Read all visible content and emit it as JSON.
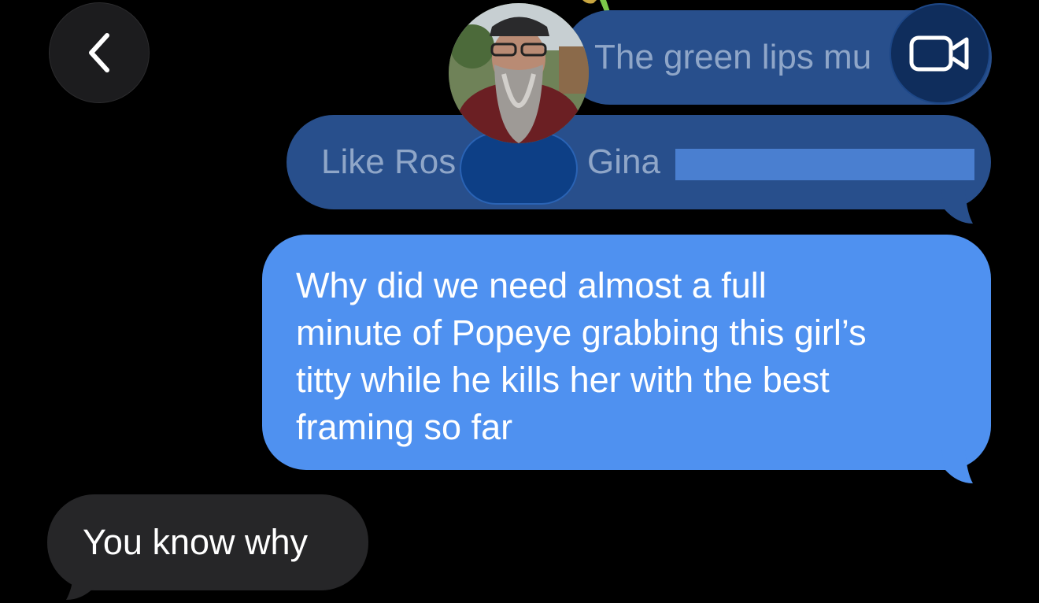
{
  "header": {
    "back_icon": "chevron-left-icon",
    "video_icon": "video-camera-icon"
  },
  "messages": [
    {
      "type": "sent",
      "faded": true,
      "text": "The green lips mu"
    },
    {
      "type": "sent",
      "faded": true,
      "text_start": "Like Ros",
      "text_end": "Gina"
    },
    {
      "type": "sent",
      "faded": false,
      "lines": [
        "Why did we need almost a full",
        "minute of Popeye grabbing this girl’s",
        "titty while he kills her with the best",
        "framing so far"
      ]
    },
    {
      "type": "received",
      "text": "You know why"
    }
  ],
  "colors": {
    "background": "#000000",
    "sent_bubble": "#4f91f0",
    "sent_faded_bubble": "#284f8c",
    "received_bubble": "#262628"
  }
}
